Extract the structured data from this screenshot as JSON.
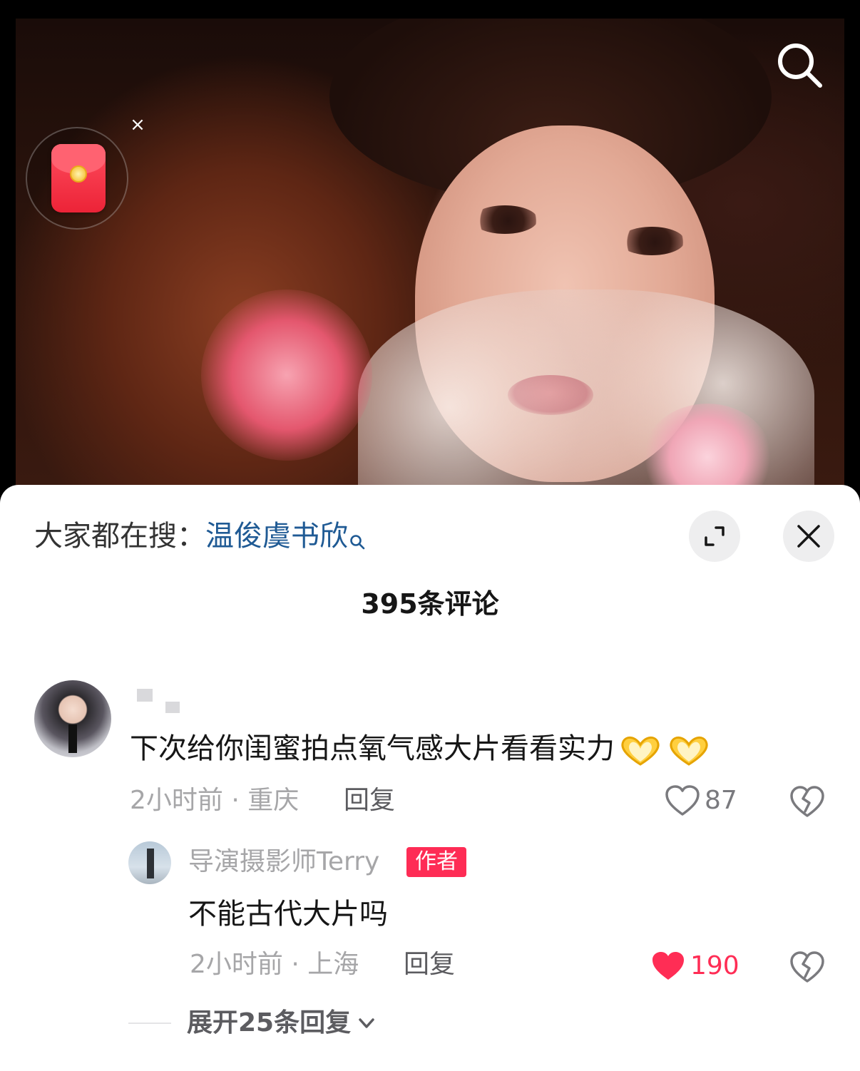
{
  "video": {
    "redpacket_close": "×"
  },
  "sheet": {
    "hot_search_prefix": "大家都在搜：",
    "hot_search_term": "温俊虞书欣",
    "comment_count": "395条评论"
  },
  "comments": [
    {
      "text": "下次给你闺蜜拍点氧气感大片看看实力",
      "emoji": [
        "heart-hands-emoji",
        "heart-hands-emoji"
      ],
      "time_location": "2小时前 · 重庆",
      "reply_label": "回复",
      "likes": "87",
      "liked": false
    }
  ],
  "reply": {
    "username": "导演摄影师Terry",
    "badge": "作者",
    "text": "不能古代大片吗",
    "time_location": "2小时前 · 上海",
    "reply_label": "回复",
    "likes": "190",
    "liked": true
  },
  "expand_replies_label": "展开25条回复",
  "colors": {
    "link_blue": "#1f5a94",
    "like_red": "#ff2d55",
    "badge_red": "#fe2c55",
    "muted_text": "#a6a6a8"
  }
}
